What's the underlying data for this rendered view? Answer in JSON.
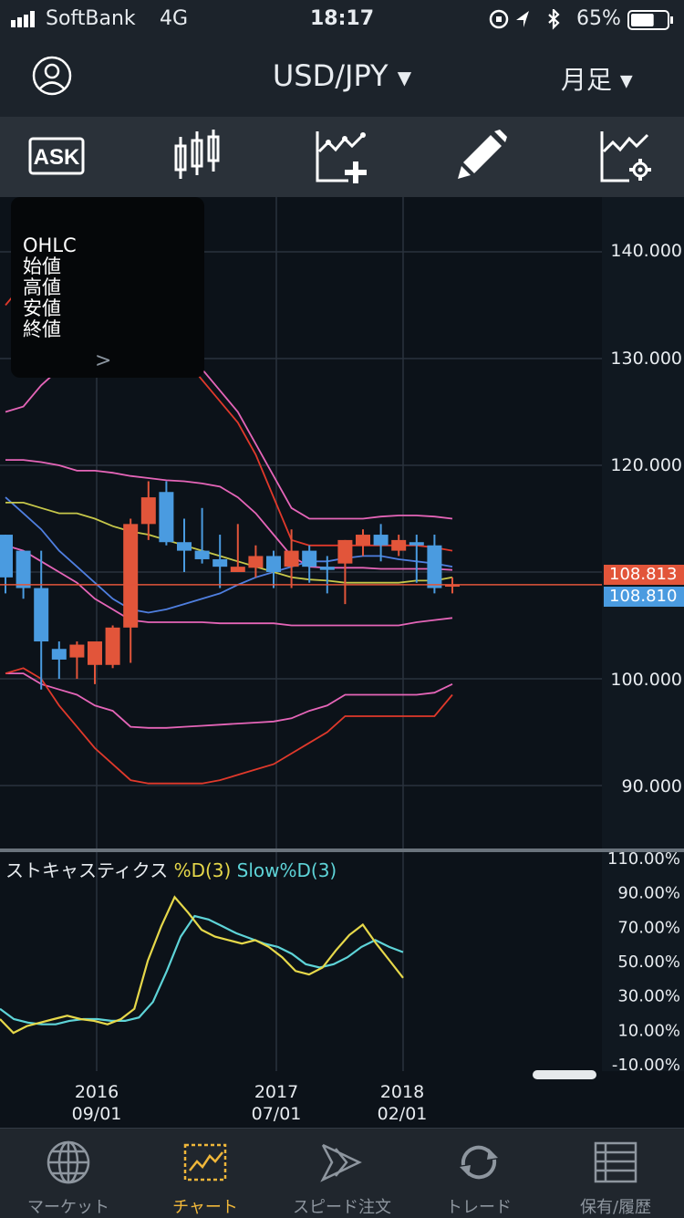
{
  "status_bar": {
    "carrier": "SoftBank",
    "network": "4G",
    "time": "18:17",
    "battery": "65%",
    "battery_level": 0.65
  },
  "header": {
    "pair": "USD/JPY",
    "period": "月足"
  },
  "toolbar": {
    "items": [
      {
        "label": "ASK",
        "icon": "ask-icon"
      },
      {
        "icon": "candlestick-icon"
      },
      {
        "icon": "add-indicator-icon"
      },
      {
        "icon": "pencil-icon"
      },
      {
        "icon": "indicator-settings-icon"
      }
    ]
  },
  "ohlc_panel": {
    "lines": [
      "OHLC",
      "始値",
      "高値",
      "安値",
      "終値"
    ]
  },
  "price_axis": {
    "labels": [
      "140.000",
      "130.000",
      "120.000",
      "100.000",
      "90.000"
    ],
    "ask_tag": "108.813",
    "bid_tag": "108.810",
    "ask_color": "#e2553a",
    "bid_color": "#4a9be0"
  },
  "stochastic": {
    "name": "ストキャスティクス",
    "d_label": "%D(3)",
    "slow_label": "Slow%D(3)",
    "d_color": "#e6d84a",
    "slow_color": "#5ed4d8",
    "axis_labels": [
      "110.00%",
      "90.00%",
      "70.00%",
      "50.00%",
      "30.00%",
      "10.00%",
      "-10.00%"
    ]
  },
  "x_axis": [
    {
      "year": "2016",
      "date": "09/01"
    },
    {
      "year": "2017",
      "date": "07/01"
    },
    {
      "year": "2018",
      "date": "02/01"
    }
  ],
  "chart_data": {
    "type": "candlestick",
    "y_range": [
      85,
      146
    ],
    "candles": [
      {
        "o": 113.5,
        "h": 113.5,
        "l": 108.0,
        "c": 109.5
      },
      {
        "o": 112.0,
        "h": 112.0,
        "l": 107.5,
        "c": 108.5
      },
      {
        "o": 108.5,
        "h": 112.0,
        "l": 99.0,
        "c": 103.5
      },
      {
        "o": 102.8,
        "h": 103.5,
        "l": 100.0,
        "c": 101.8
      },
      {
        "o": 102.0,
        "h": 103.5,
        "l": 100.0,
        "c": 103.2
      },
      {
        "o": 101.3,
        "h": 103.2,
        "l": 99.5,
        "c": 103.5
      },
      {
        "o": 101.3,
        "h": 105.0,
        "l": 101.0,
        "c": 104.8
      },
      {
        "o": 104.8,
        "h": 115.0,
        "l": 101.5,
        "c": 114.5
      },
      {
        "o": 114.5,
        "h": 118.5,
        "l": 113.0,
        "c": 117.0
      },
      {
        "o": 117.5,
        "h": 118.5,
        "l": 112.5,
        "c": 112.8
      },
      {
        "o": 112.8,
        "h": 115.0,
        "l": 110.0,
        "c": 112.0
      },
      {
        "o": 112.0,
        "h": 116.0,
        "l": 110.8,
        "c": 111.2
      },
      {
        "o": 111.2,
        "h": 113.5,
        "l": 108.5,
        "c": 110.5
      },
      {
        "o": 110.0,
        "h": 114.5,
        "l": 110.0,
        "c": 110.5
      },
      {
        "o": 110.4,
        "h": 112.5,
        "l": 109.5,
        "c": 111.5
      },
      {
        "o": 111.5,
        "h": 112.0,
        "l": 108.5,
        "c": 110.0
      },
      {
        "o": 110.5,
        "h": 114.0,
        "l": 108.5,
        "c": 112.0
      },
      {
        "o": 112.0,
        "h": 112.5,
        "l": 109.0,
        "c": 110.5
      },
      {
        "o": 110.5,
        "h": 111.5,
        "l": 108.0,
        "c": 110.2
      },
      {
        "o": 110.8,
        "h": 113.0,
        "l": 107.0,
        "c": 113.0
      },
      {
        "o": 112.5,
        "h": 114.0,
        "l": 111.5,
        "c": 113.5
      },
      {
        "o": 113.5,
        "h": 114.5,
        "l": 111.0,
        "c": 112.5
      },
      {
        "o": 112.0,
        "h": 113.5,
        "l": 111.5,
        "c": 113.0
      },
      {
        "o": 112.8,
        "h": 113.5,
        "l": 109.0,
        "c": 112.5
      },
      {
        "o": 112.5,
        "h": 113.5,
        "l": 108.0,
        "c": 108.5
      },
      {
        "o": 108.8,
        "h": 109.5,
        "l": 108.0,
        "c": 108.8
      }
    ],
    "bands": [
      {
        "color": "#e0392b",
        "values": [
          135,
          137,
          139,
          139,
          138.5,
          137.5,
          137,
          135,
          133,
          131,
          130,
          128,
          126,
          124,
          121,
          117,
          113,
          112.5,
          112.5,
          112.5,
          112.5,
          112.5,
          112.5,
          112.5,
          112.3,
          112
        ]
      },
      {
        "color": "#e565b8",
        "values": [
          125,
          125.5,
          127.5,
          129,
          129.5,
          130,
          130.5,
          131,
          130.5,
          130,
          129.5,
          129,
          127,
          125,
          122,
          119,
          116,
          115,
          115,
          115,
          115,
          115.2,
          115.3,
          115.3,
          115.2,
          115
        ]
      },
      {
        "color": "#e565b8",
        "values": [
          120.5,
          120.5,
          120.3,
          120,
          119.5,
          119.5,
          119.3,
          119,
          118.8,
          118.6,
          118.5,
          118.3,
          118,
          117,
          115.5,
          113.5,
          111.5,
          110.5,
          110.4,
          110.4,
          110.4,
          110.3,
          110.3,
          110.3,
          110.3,
          110.2
        ]
      },
      {
        "color": "#4f7fe0",
        "values": [
          117,
          115.5,
          114,
          112,
          110.5,
          109,
          107.5,
          106.5,
          106.2,
          106.5,
          107,
          107.5,
          108,
          108.8,
          109.5,
          110,
          110.5,
          111,
          111,
          111.3,
          111.5,
          111.5,
          111.2,
          111.0,
          110.8,
          110.5
        ]
      },
      {
        "color": "#c6c74a",
        "values": [
          116.5,
          116.5,
          116,
          115.5,
          115.5,
          115,
          114.3,
          113.8,
          113.5,
          113,
          112.5,
          112,
          111.5,
          111,
          110.5,
          110,
          109.5,
          109.3,
          109.2,
          109,
          109,
          109,
          109,
          109.2,
          109.2,
          109.5
        ]
      },
      {
        "color": "#e565b8",
        "values": [
          112.5,
          112,
          111,
          110,
          109,
          107.5,
          106.5,
          105.5,
          105.3,
          105.3,
          105.3,
          105.3,
          105.2,
          105.2,
          105.2,
          105.2,
          105.0,
          105.0,
          105.0,
          105.0,
          105.0,
          105.0,
          105.0,
          105.3,
          105.5,
          105.7
        ]
      },
      {
        "color": "#e565b8",
        "values": [
          100.5,
          100.5,
          99.5,
          99,
          98.5,
          97.5,
          97,
          95.5,
          95.4,
          95.4,
          95.5,
          95.6,
          95.7,
          95.8,
          95.9,
          96,
          96.3,
          97,
          97.5,
          98.5,
          98.5,
          98.5,
          98.5,
          98.5,
          98.7,
          99.5
        ]
      },
      {
        "color": "#e0392b",
        "values": [
          100.5,
          101,
          100,
          97.5,
          95.5,
          93.5,
          92,
          90.5,
          90.2,
          90.2,
          90.2,
          90.2,
          90.5,
          91,
          91.5,
          92,
          93,
          94,
          95,
          96.5,
          96.5,
          96.5,
          96.5,
          96.5,
          96.5,
          98.5
        ]
      }
    ],
    "ask_line": 108.813,
    "stoch_range": [
      -10,
      110
    ],
    "stoch_d": [
      16,
      8,
      12,
      14,
      16,
      18,
      16,
      15,
      13,
      16,
      22,
      50,
      70,
      87,
      78,
      68,
      64,
      62,
      60,
      62,
      58,
      52,
      44,
      42,
      46,
      56,
      65,
      71,
      60,
      50,
      40
    ],
    "stoch_slow": [
      22,
      16,
      14,
      13,
      13,
      15,
      16,
      16,
      15,
      15,
      17,
      26,
      44,
      64,
      76,
      74,
      70,
      66,
      63,
      60,
      58,
      54,
      48,
      46,
      48,
      52,
      58,
      62,
      58,
      55
    ]
  },
  "tabs": [
    {
      "label": "マーケット",
      "icon": "globe-icon"
    },
    {
      "label": "チャート",
      "icon": "chart-icon",
      "active": true
    },
    {
      "label": "スピード注文",
      "icon": "speed-order-icon"
    },
    {
      "label": "トレード",
      "icon": "trade-icon"
    },
    {
      "label": "保有/履歴",
      "icon": "history-icon"
    }
  ]
}
